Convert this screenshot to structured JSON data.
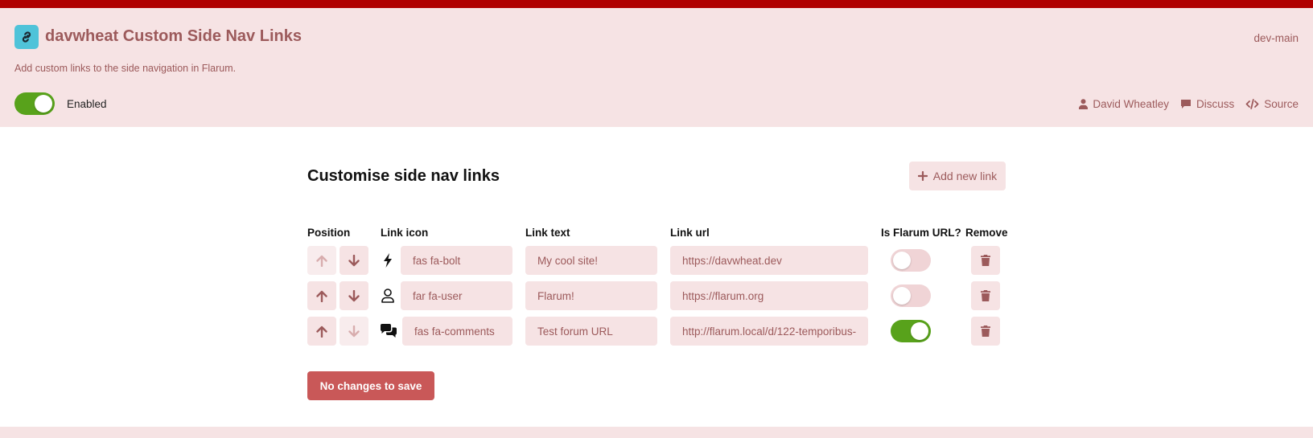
{
  "header": {
    "title": "davwheat Custom Side Nav Links",
    "version": "dev-main",
    "description": "Add custom links to the side navigation in Flarum.",
    "enabled_label": "Enabled",
    "enabled": true,
    "links": [
      {
        "label": "David Wheatley",
        "icon": "user-icon"
      },
      {
        "label": "Discuss",
        "icon": "comment-icon"
      },
      {
        "label": "Source",
        "icon": "code-icon"
      }
    ]
  },
  "main": {
    "section_title": "Customise side nav links",
    "add_button_label": "Add new link",
    "columns": {
      "position": "Position",
      "link_icon": "Link icon",
      "link_text": "Link text",
      "link_url": "Link url",
      "is_flarum": "Is Flarum URL?",
      "remove": "Remove"
    },
    "rows": [
      {
        "icon_class": "fas fa-bolt",
        "icon": "bolt-icon",
        "text": "My cool site!",
        "url": "https://davwheat.dev",
        "is_flarum": false,
        "up_disabled": true,
        "down_disabled": false
      },
      {
        "icon_class": "far fa-user",
        "icon": "user-outline-icon",
        "text": "Flarum!",
        "url": "https://flarum.org",
        "is_flarum": false,
        "up_disabled": false,
        "down_disabled": false
      },
      {
        "icon_class": "fas fa-comments",
        "icon": "comments-icon",
        "text": "Test forum URL",
        "url": "http://flarum.local/d/122-temporibus-",
        "is_flarum": true,
        "up_disabled": false,
        "down_disabled": true
      }
    ],
    "save_button_label": "No changes to save"
  },
  "colors": {
    "accent": "#9c5a5b",
    "topbar": "#b00000",
    "header_bg": "#f6e3e4",
    "toggle_on": "#58a21b",
    "save_button": "#c95858",
    "ext_icon_bg": "#4fc3d9"
  }
}
